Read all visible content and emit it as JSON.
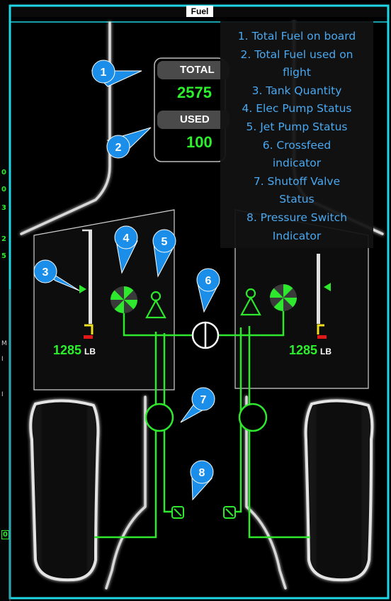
{
  "title": "Fuel",
  "total_label": "TOTAL",
  "total_value": "2575",
  "used_label": "USED",
  "used_value": "100",
  "legend": [
    "1. Total Fuel on board",
    "2. Total Fuel used on",
    "flight",
    "3. Tank Quantity",
    "4. Elec Pump Status",
    "5. Jet Pump Status",
    "6. Crossfeed",
    "indicator",
    "7. Shutoff Valve",
    "Status",
    "8. Pressure Switch",
    "Indicator"
  ],
  "markers": [
    "1",
    "2",
    "3",
    "4",
    "5",
    "6",
    "7",
    "8"
  ],
  "left_tank": {
    "value": "1285",
    "unit": "LB"
  },
  "right_tank": {
    "value": "1285",
    "unit": "LB"
  },
  "left_strip": [
    "0",
    "0",
    "3",
    "2",
    "5",
    "M",
    "I",
    "I",
    "0"
  ],
  "colors": {
    "fuel_line": "#2ee82e",
    "callout": "#1a8ee8",
    "legend_text": "#4aa8f0",
    "bezel": "#1fd6e6"
  }
}
